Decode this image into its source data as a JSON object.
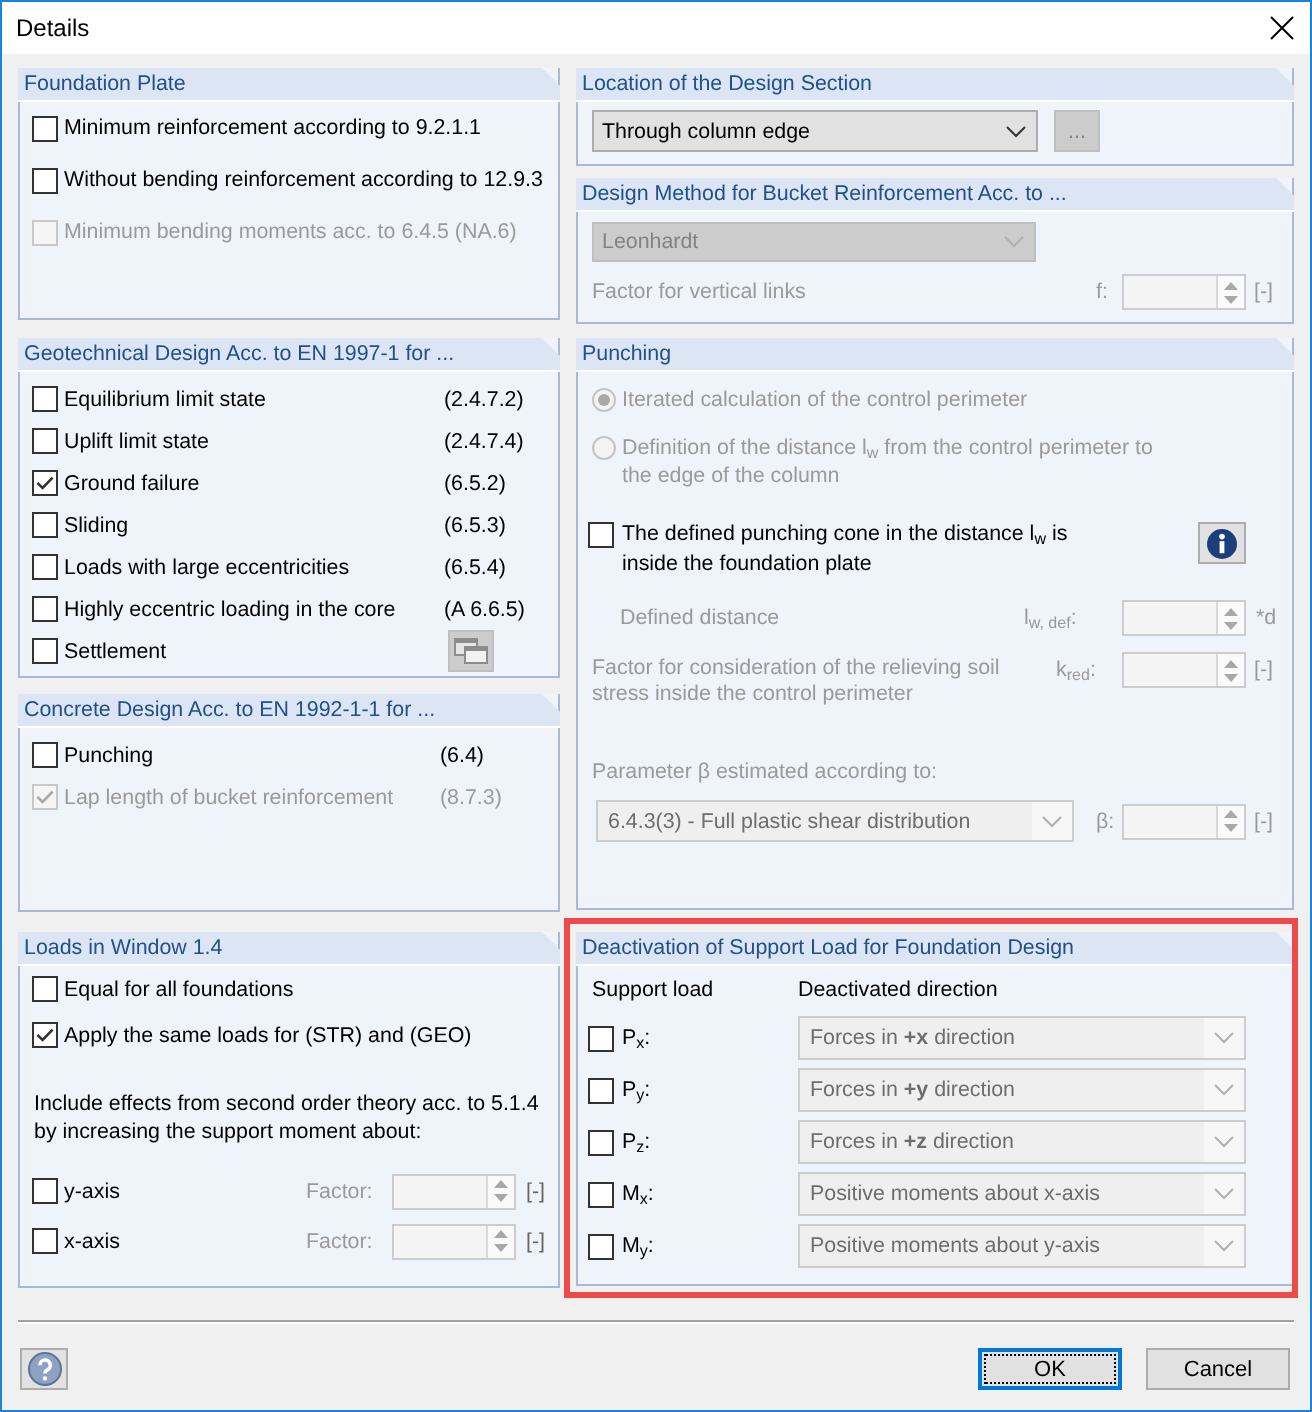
{
  "window": {
    "title": "Details"
  },
  "foundation_plate": {
    "title": "Foundation Plate",
    "options": [
      {
        "label": "Minimum reinforcement according to 9.2.1.1",
        "checked": false,
        "disabled": false
      },
      {
        "label": "Without bending reinforcement according to 12.9.3",
        "checked": false,
        "disabled": false
      },
      {
        "label": "Minimum bending moments acc. to 6.4.5 (NA.6)",
        "checked": false,
        "disabled": true
      }
    ]
  },
  "geotechnical_design": {
    "title": "Geotechnical Design Acc. to EN 1997-1 for ...",
    "options": [
      {
        "kind": "reference",
        "label": "Equilibrium limit state",
        "reference": "(2.4.7.2)",
        "checked": false
      },
      {
        "kind": "reference",
        "label": "Uplift limit state",
        "reference": "(2.4.7.4)",
        "checked": false
      },
      {
        "kind": "reference",
        "label": "Ground failure",
        "reference": "(6.5.2)",
        "checked": true
      },
      {
        "kind": "reference",
        "label": "Sliding",
        "reference": "(6.5.3)",
        "checked": false
      },
      {
        "kind": "reference",
        "label": "Loads with large eccentricities",
        "reference": "(6.5.4)",
        "checked": false
      },
      {
        "kind": "reference",
        "label": "Highly eccentric loading in the core",
        "reference": "(A 6.6.5)",
        "checked": false
      },
      {
        "kind": "button",
        "label": "Settlement",
        "checked": false,
        "button_disabled": true
      }
    ]
  },
  "concrete_design": {
    "title": "Concrete Design Acc. to EN 1992-1-1 for ...",
    "options": [
      {
        "label": "Punching",
        "reference": "(6.4)",
        "checked": false,
        "disabled": false
      },
      {
        "label": "Lap length of bucket reinforcement",
        "reference": "(8.7.3)",
        "checked": true,
        "disabled": true
      }
    ]
  },
  "loads_in_window": {
    "title": "Loads in Window 1.4",
    "options": [
      {
        "label": "Equal for all foundations",
        "checked": false
      },
      {
        "label": "Apply the same loads for (STR) and (GEO)",
        "checked": true
      }
    ],
    "note": "Include effects from second order theory acc. to 5.1.4 by increasing the support moment about:",
    "axes": [
      {
        "label": "y-axis",
        "checked": false,
        "factor_label": "Factor:",
        "unit": "[-]",
        "disabled": true
      },
      {
        "label": "x-axis",
        "checked": false,
        "factor_label": "Factor:",
        "unit": "[-]",
        "disabled": true
      }
    ]
  },
  "design_section": {
    "title": "Location of the Design Section",
    "dropdown": {
      "value": "Through column edge",
      "disabled": false
    },
    "more_button": {
      "label": "...",
      "disabled": true
    }
  },
  "design_method": {
    "title": "Design Method for Bucket Reinforcement Acc. to ...",
    "dropdown": {
      "value": "Leonhardt",
      "disabled": true
    },
    "factor": {
      "label": "Factor for vertical links",
      "symbol": "f:",
      "unit": "[-]",
      "disabled": true
    }
  },
  "punching": {
    "title": "Punching",
    "radios": [
      {
        "label": "Iterated calculation of the control perimeter",
        "selected": true,
        "disabled": true
      },
      {
        "label": "Definition of the distance l$_{w}$ from the control perimeter to the edge of the column",
        "selected": false,
        "disabled": true
      }
    ],
    "cone_option": {
      "label": "The defined punching cone in the distance l$_{w}$ is inside the foundation plate",
      "checked": false,
      "distance_field": {
        "label": "Defined distance",
        "symbol": "l$_{w, def}$:",
        "unit": "*d",
        "disabled": true
      }
    },
    "relief_field": {
      "label": "Factor for consideration of the relieving soil stress inside the control perimeter",
      "symbol": "k$_{red}$:",
      "unit": "[-]",
      "disabled": true
    },
    "beta": {
      "label": "Parameter β estimated according to:",
      "dropdown": {
        "value": "6.4.3(3) - Full plastic shear distribution",
        "disabled": true
      },
      "symbol": "β:",
      "unit": "[-]",
      "disabled": true
    }
  },
  "support_load_deactivation": {
    "title": "Deactivation of Support Load for Foundation Design",
    "highlighted": true,
    "headers": [
      "Support load",
      "Deactivated direction"
    ],
    "rows": [
      {
        "label": "P$_{x}$:",
        "checked": false,
        "direction": "Forces in **+x** direction",
        "disabled": true
      },
      {
        "label": "P$_{y}$:",
        "checked": false,
        "direction": "Forces in **+y** direction",
        "disabled": true
      },
      {
        "label": "P$_{z}$:",
        "checked": false,
        "direction": "Forces in **+z** direction",
        "disabled": true
      },
      {
        "label": "M$_{x}$:",
        "checked": false,
        "direction": "Positive moments about x-axis",
        "disabled": true
      },
      {
        "label": "M$_{y}$:",
        "checked": false,
        "direction": "Positive moments about y-axis",
        "disabled": true
      }
    ]
  },
  "footer": {
    "buttons": [
      {
        "label": "OK",
        "focused": true
      },
      {
        "label": "Cancel",
        "focused": false
      }
    ]
  }
}
